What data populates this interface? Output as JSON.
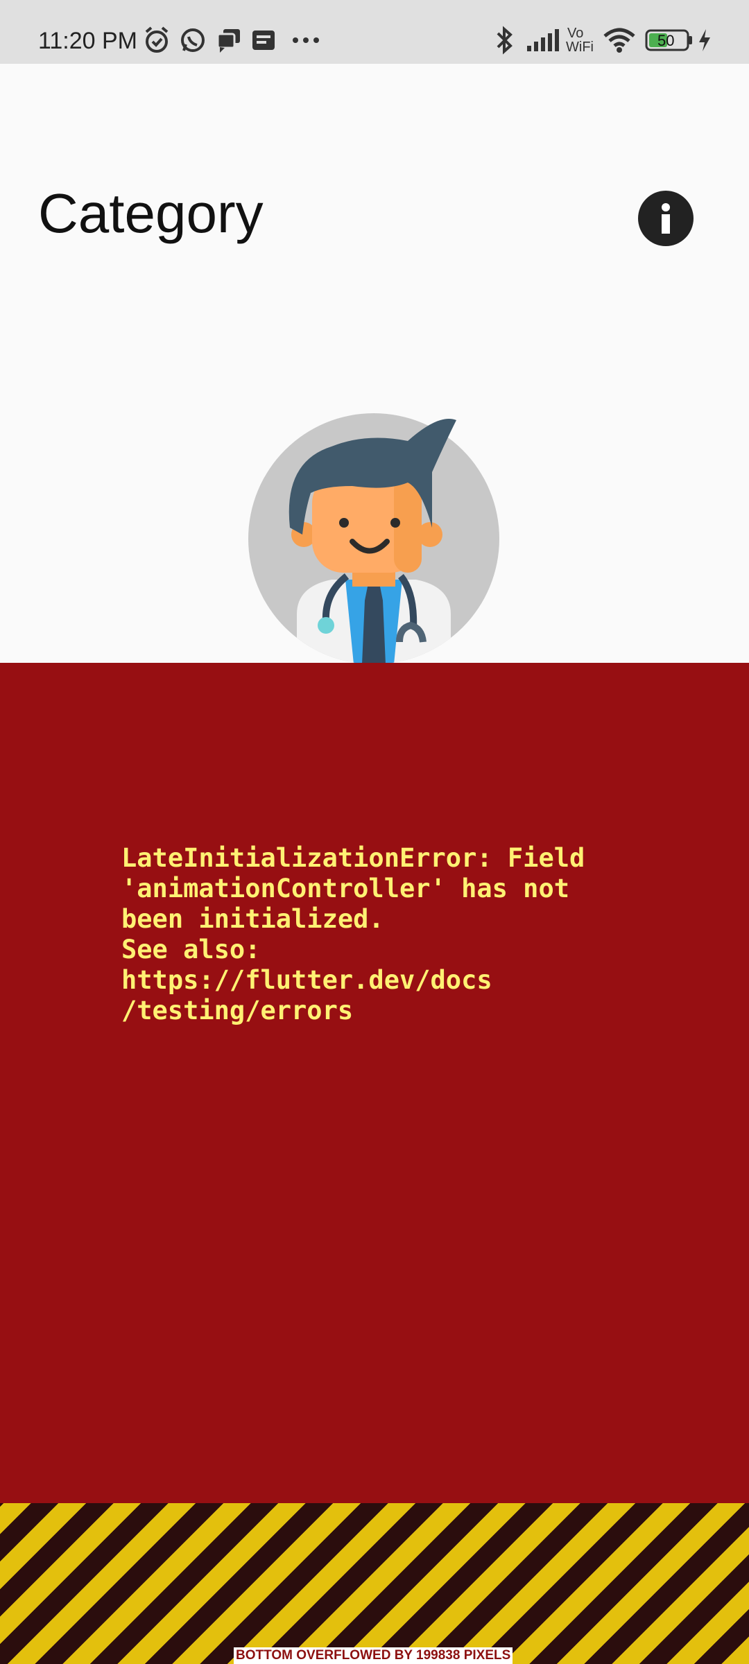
{
  "status_bar": {
    "time": "11:20 PM",
    "notification_icons": [
      "alarm-icon",
      "whatsapp-icon",
      "chat-icon",
      "message-icon",
      "more-dots-icon"
    ],
    "system_icons": [
      "bluetooth-icon",
      "cellular-signal-icon",
      "vowifi-icon",
      "wifi-icon",
      "battery-icon",
      "charging-icon"
    ],
    "vowifi_top": "Vo",
    "vowifi_bottom": "WiFi",
    "battery_level": "50"
  },
  "header": {
    "title": "Category",
    "info_icon": "info-icon"
  },
  "avatar": {
    "icon": "doctor-avatar-icon"
  },
  "error": {
    "message": "LateInitializationError: Field\n'animationController' has not\nbeen initialized.\nSee also:\nhttps://flutter.dev/docs\n/testing/errors"
  },
  "overflow": {
    "label": "BOTTOM OVERFLOWED BY 199838 PIXELS"
  },
  "colors": {
    "error_background": "#970f12",
    "error_text": "#fff173",
    "stripe_yellow": "#e3c00d",
    "stripe_dark": "#2b0d0d",
    "status_bar": "#e0e0e0",
    "battery_fill": "#4caf50"
  }
}
